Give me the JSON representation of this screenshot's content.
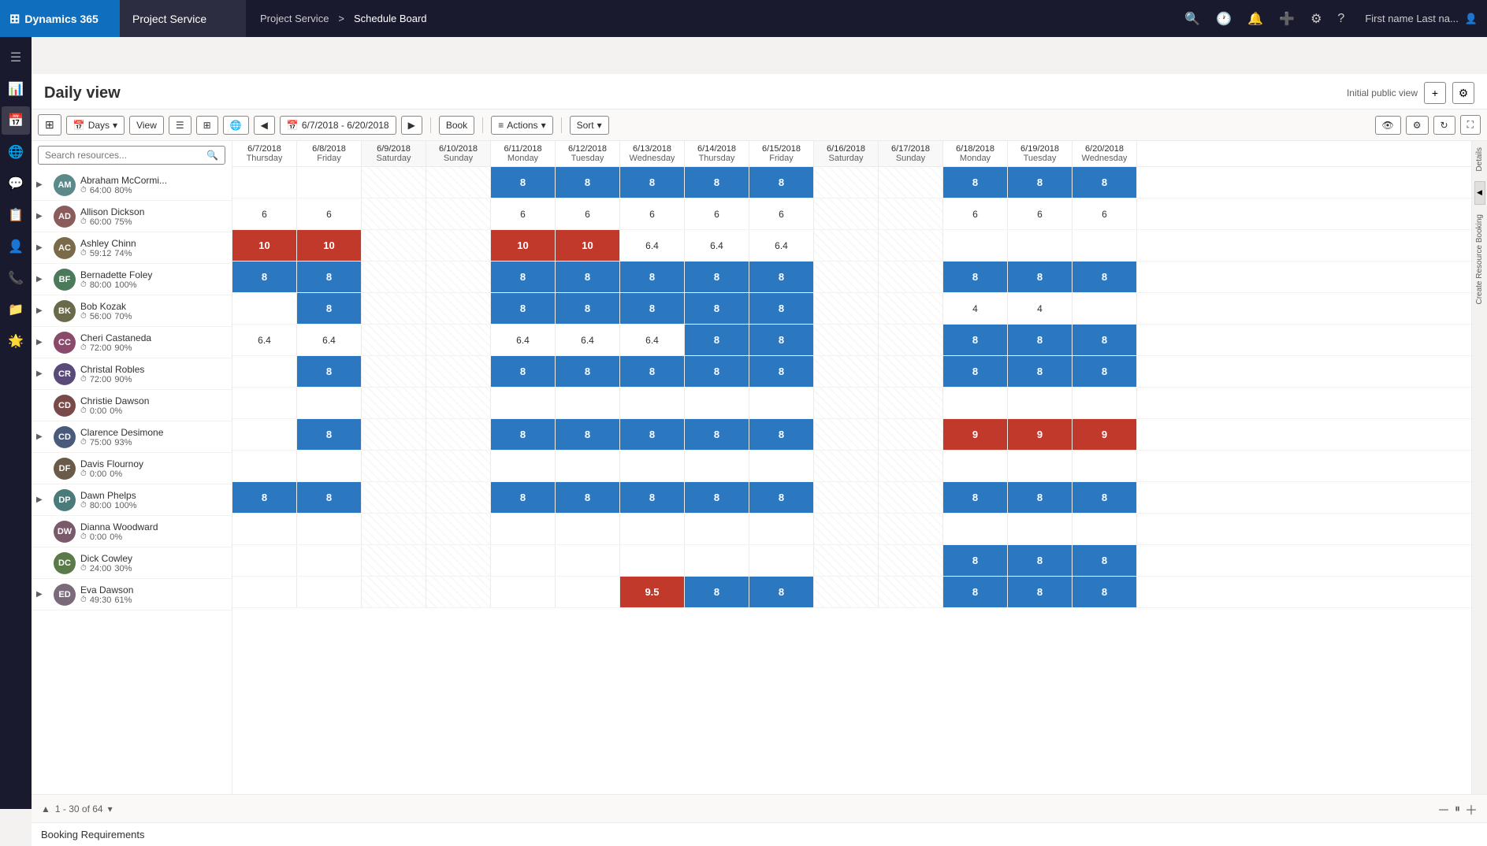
{
  "nav": {
    "brand": "Dynamics 365",
    "app_name": "Project Service",
    "breadcrumb_part1": "Project Service",
    "breadcrumb_separator": ">",
    "breadcrumb_part2": "Schedule Board",
    "user_label": "First name Last na...",
    "icons": [
      "🔍",
      "🕐",
      "🔔",
      "➕",
      "⚙",
      "?"
    ]
  },
  "sidebar": {
    "items": [
      {
        "icon": "☰",
        "name": "menu"
      },
      {
        "icon": "📊",
        "name": "dashboard"
      },
      {
        "icon": "🌐",
        "name": "map"
      },
      {
        "icon": "💬",
        "name": "chat"
      },
      {
        "icon": "📋",
        "name": "tasks"
      },
      {
        "icon": "👤",
        "name": "user"
      },
      {
        "icon": "📞",
        "name": "phone"
      },
      {
        "icon": "📁",
        "name": "folder"
      },
      {
        "icon": "🌟",
        "name": "star"
      }
    ]
  },
  "page": {
    "title": "Daily view",
    "view_label": "Initial public view",
    "add_btn": "+",
    "settings_btn": "⚙"
  },
  "toolbar": {
    "days_label": "Days",
    "view_label": "View",
    "book_label": "Book",
    "actions_label": "Actions",
    "sort_label": "Sort",
    "search_placeholder": "Search resources..."
  },
  "date_range": "6/7/2018 - 6/20/2018",
  "columns": [
    {
      "date": "6/7/2018",
      "weekday": "Thursday"
    },
    {
      "date": "6/8/2018",
      "weekday": "Friday"
    },
    {
      "date": "6/9/2018",
      "weekday": "Saturday"
    },
    {
      "date": "6/10/2018",
      "weekday": "Sunday"
    },
    {
      "date": "6/11/2018",
      "weekday": "Monday"
    },
    {
      "date": "6/12/2018",
      "weekday": "Tuesday"
    },
    {
      "date": "6/13/2018",
      "weekday": "Wednesday"
    },
    {
      "date": "6/14/2018",
      "weekday": "Thursday"
    },
    {
      "date": "6/15/2018",
      "weekday": "Friday"
    },
    {
      "date": "6/16/2018",
      "weekday": "Saturday"
    },
    {
      "date": "6/17/2018",
      "weekday": "Sunday"
    },
    {
      "date": "6/18/2018",
      "weekday": "Monday"
    },
    {
      "date": "6/19/2018",
      "weekday": "Tuesday"
    },
    {
      "date": "6/20/2018",
      "weekday": "Wednesday"
    }
  ],
  "resources": [
    {
      "name": "Abraham McCormi...",
      "hours": "64:00",
      "pct": "80%",
      "initials": "AM",
      "color": "#5c8a8a",
      "cells": [
        "",
        "",
        "",
        "",
        "8",
        "8",
        "8",
        "8",
        "8",
        "",
        "",
        "8",
        "8",
        "8"
      ],
      "cell_types": [
        "",
        "",
        "",
        "",
        "blue",
        "blue",
        "blue",
        "blue",
        "blue",
        "",
        "",
        "blue",
        "blue",
        "blue"
      ]
    },
    {
      "name": "Allison Dickson",
      "hours": "60:00",
      "pct": "75%",
      "initials": "AD",
      "color": "#8a5c5c",
      "cells": [
        "6",
        "6",
        "",
        "",
        "6",
        "6",
        "6",
        "6",
        "6",
        "",
        "",
        "6",
        "6",
        "6"
      ],
      "cell_types": [
        "val",
        "val",
        "",
        "",
        "val",
        "val",
        "val",
        "val",
        "val",
        "",
        "",
        "val",
        "val",
        "val"
      ]
    },
    {
      "name": "Ashley Chinn",
      "hours": "59:12",
      "pct": "74%",
      "initials": "AC",
      "color": "#7a6a4a",
      "cells": [
        "10",
        "10",
        "",
        "",
        "10",
        "10",
        "6.4",
        "6.4",
        "6.4",
        "",
        "",
        "",
        "",
        ""
      ],
      "cell_types": [
        "red",
        "red",
        "",
        "",
        "red",
        "red",
        "val",
        "val",
        "val",
        "",
        "",
        "",
        "",
        ""
      ]
    },
    {
      "name": "Bernadette Foley",
      "hours": "80:00",
      "pct": "100%",
      "initials": "BF",
      "color": "#4a7a5a",
      "cells": [
        "8",
        "8",
        "",
        "",
        "8",
        "8",
        "8",
        "8",
        "8",
        "",
        "",
        "8",
        "8",
        "8"
      ],
      "cell_types": [
        "blue",
        "blue",
        "",
        "",
        "blue",
        "blue",
        "blue",
        "blue",
        "blue",
        "",
        "",
        "blue",
        "blue",
        "blue"
      ]
    },
    {
      "name": "Bob Kozak",
      "hours": "56:00",
      "pct": "70%",
      "initials": "BK",
      "color": "#6a6a4a",
      "cells": [
        "",
        "8",
        "",
        "",
        "8",
        "8",
        "8",
        "8",
        "8",
        "",
        "",
        "4",
        "4",
        ""
      ],
      "cell_types": [
        "",
        "blue",
        "",
        "",
        "blue",
        "blue",
        "blue",
        "blue",
        "blue",
        "",
        "",
        "val",
        "val",
        ""
      ]
    },
    {
      "name": "Cheri Castaneda",
      "hours": "72:00",
      "pct": "90%",
      "initials": "CC",
      "color": "#8a4a6a",
      "cells": [
        "6.4",
        "6.4",
        "",
        "",
        "6.4",
        "6.4",
        "6.4",
        "8",
        "8",
        "",
        "",
        "8",
        "8",
        "8"
      ],
      "cell_types": [
        "val",
        "val",
        "",
        "",
        "val",
        "val",
        "val",
        "blue",
        "blue",
        "",
        "",
        "blue",
        "blue",
        "blue"
      ]
    },
    {
      "name": "Christal Robles",
      "hours": "72:00",
      "pct": "90%",
      "initials": "CR",
      "color": "#5a4a7a",
      "cells": [
        "",
        "8",
        "",
        "",
        "8",
        "8",
        "8",
        "8",
        "8",
        "",
        "",
        "8",
        "8",
        "8"
      ],
      "cell_types": [
        "",
        "blue",
        "",
        "",
        "blue",
        "blue",
        "blue",
        "blue",
        "blue",
        "",
        "",
        "blue",
        "blue",
        "blue"
      ]
    },
    {
      "name": "Christie Dawson",
      "hours": "0:00",
      "pct": "0%",
      "initials": "CD",
      "color": "#7a4a4a",
      "cells": [
        "",
        "",
        "",
        "",
        "",
        "",
        "",
        "",
        "",
        "",
        "",
        "",
        "",
        ""
      ],
      "cell_types": [
        "",
        "",
        "",
        "",
        "",
        "",
        "",
        "",
        "",
        "",
        "",
        "",
        "",
        ""
      ]
    },
    {
      "name": "Clarence Desimone",
      "hours": "75:00",
      "pct": "93%",
      "initials": "CD",
      "color": "#4a5a7a",
      "cells": [
        "",
        "8",
        "",
        "",
        "8",
        "8",
        "8",
        "8",
        "8",
        "",
        "",
        "9",
        "9",
        "9"
      ],
      "cell_types": [
        "",
        "blue",
        "",
        "",
        "blue",
        "blue",
        "blue",
        "blue",
        "blue",
        "",
        "",
        "red",
        "red",
        "red"
      ]
    },
    {
      "name": "Davis Flournoy",
      "hours": "0:00",
      "pct": "0%",
      "initials": "DF",
      "color": "#6a5a4a",
      "cells": [
        "",
        "",
        "",
        "",
        "",
        "",
        "",
        "",
        "",
        "",
        "",
        "",
        "",
        ""
      ],
      "cell_types": [
        "",
        "",
        "",
        "",
        "",
        "",
        "",
        "",
        "",
        "",
        "",
        "",
        "",
        ""
      ]
    },
    {
      "name": "Dawn Phelps",
      "hours": "80:00",
      "pct": "100%",
      "initials": "DP",
      "color": "#4a7a7a",
      "cells": [
        "8",
        "8",
        "",
        "",
        "8",
        "8",
        "8",
        "8",
        "8",
        "",
        "",
        "8",
        "8",
        "8"
      ],
      "cell_types": [
        "blue",
        "blue",
        "",
        "",
        "blue",
        "blue",
        "blue",
        "blue",
        "blue",
        "",
        "",
        "blue",
        "blue",
        "blue"
      ]
    },
    {
      "name": "Dianna Woodward",
      "hours": "0:00",
      "pct": "0%",
      "initials": "DW",
      "color": "#7a5a6a",
      "cells": [
        "",
        "",
        "",
        "",
        "",
        "",
        "",
        "",
        "",
        "",
        "",
        "",
        "",
        ""
      ],
      "cell_types": [
        "",
        "",
        "",
        "",
        "",
        "",
        "",
        "",
        "",
        "",
        "",
        "",
        "",
        ""
      ]
    },
    {
      "name": "Dick Cowley",
      "hours": "24:00",
      "pct": "30%",
      "initials": "DC",
      "color": "#5a7a4a",
      "cells": [
        "",
        "",
        "",
        "",
        "",
        "",
        "",
        "",
        "",
        "",
        "",
        "8",
        "8",
        "8"
      ],
      "cell_types": [
        "",
        "",
        "",
        "",
        "",
        "",
        "",
        "",
        "",
        "",
        "",
        "blue",
        "blue",
        "blue"
      ]
    },
    {
      "name": "Eva Dawson",
      "hours": "49:30",
      "pct": "61%",
      "initials": "ED",
      "color": "#7a6a7a",
      "cells": [
        "",
        "",
        "",
        "",
        "",
        "",
        "9.5",
        "8",
        "8",
        "",
        "",
        "8",
        "8",
        "8"
      ],
      "cell_types": [
        "",
        "",
        "",
        "",
        "",
        "",
        "red",
        "blue",
        "blue",
        "",
        "",
        "blue",
        "blue",
        "blue"
      ]
    }
  ],
  "bottom": {
    "pagination": "1 - 30 of 64",
    "booking_req": "Booking Requirements"
  }
}
